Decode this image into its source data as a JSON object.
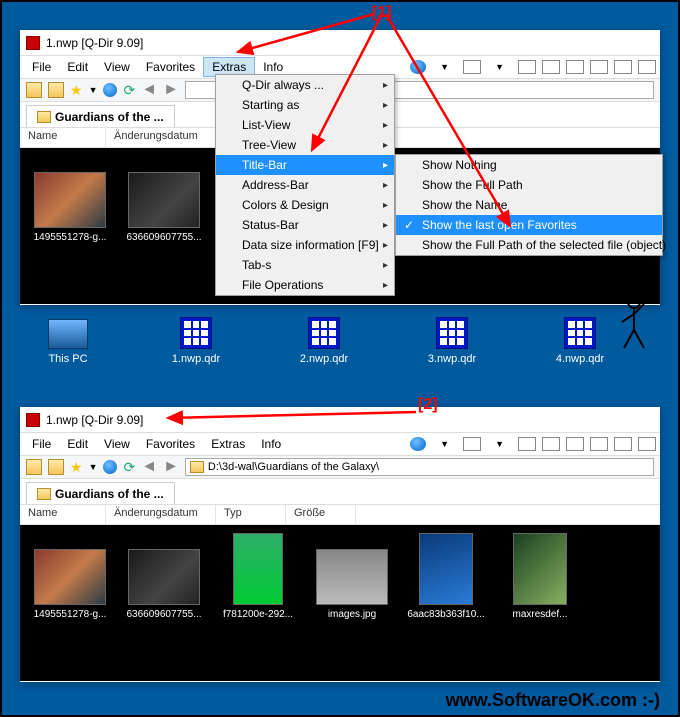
{
  "annotations": {
    "one": "[1]",
    "two": "[2]"
  },
  "window": {
    "title": "1.nwp  [Q-Dir 9.09]",
    "menu": {
      "file": "File",
      "edit": "Edit",
      "view": "View",
      "favorites": "Favorites",
      "extras": "Extras",
      "info": "Info"
    }
  },
  "pathbar": "D:\\3d-wal\\Guardians of the Galaxy\\",
  "tab": "Guardians of the ...",
  "columns": {
    "name": "Name",
    "date": "Änderungsdatum",
    "type": "Typ",
    "size": "Größe"
  },
  "extras_menu": {
    "always": "Q-Dir always ...",
    "starting": "Starting as",
    "listview": "List-View",
    "treeview": "Tree-View",
    "titlebar": "Title-Bar",
    "addressbar": "Address-Bar",
    "colors": "Colors & Design",
    "statusbar": "Status-Bar",
    "datasize": "Data size information  [F9]",
    "tabs": "Tab-s",
    "fileops": "File Operations"
  },
  "titlebar_submenu": {
    "nothing": "Show Nothing",
    "fullpath": "Show the Full Path",
    "name": "Show the Name",
    "lastfav": "Show the last open Favorites",
    "fullpathsel": "Show the Full Path of the selected file (object)"
  },
  "files": [
    {
      "label": "1495551278-g..."
    },
    {
      "label": "636609607755..."
    },
    {
      "label": "f781200e-292..."
    },
    {
      "label": "images.jpg"
    },
    {
      "label": "6aac83b363f10..."
    },
    {
      "label": "maxresdef..."
    }
  ],
  "desktop": {
    "pc": "This PC",
    "f1": "1.nwp.qdr",
    "f2": "2.nwp.qdr",
    "f3": "3.nwp.qdr",
    "f4": "4.nwp.qdr"
  },
  "footer": "www.SoftwareOK.com :-)"
}
